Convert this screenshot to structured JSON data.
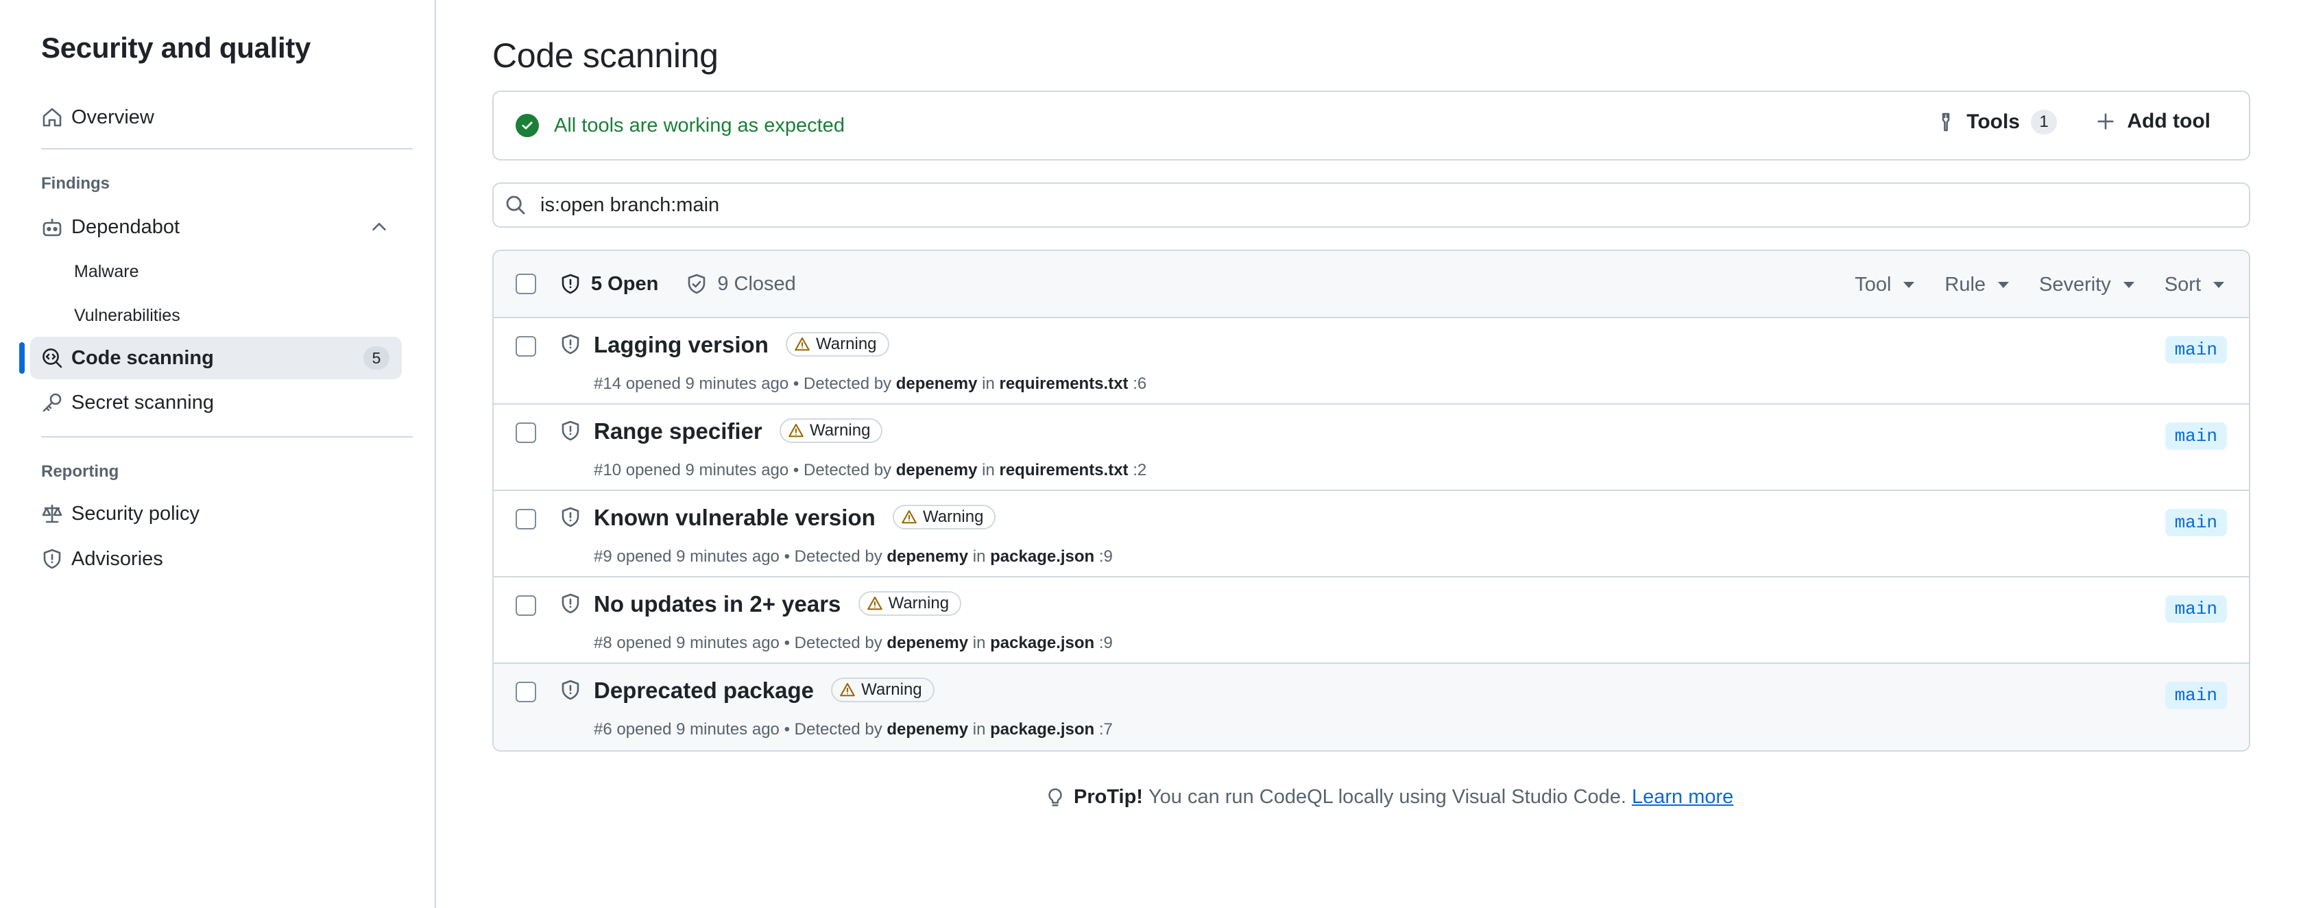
{
  "sidebar": {
    "title": "Security and quality",
    "overview": "Overview",
    "findings_heading": "Findings",
    "dependabot": "Dependabot",
    "malware": "Malware",
    "vulnerabilities": "Vulnerabilities",
    "code_scanning": "Code scanning",
    "code_scanning_count": "5",
    "secret_scanning": "Secret scanning",
    "reporting_heading": "Reporting",
    "security_policy": "Security policy",
    "advisories": "Advisories"
  },
  "main": {
    "title": "Code scanning",
    "status_text": "All tools are working as expected",
    "tools_label": "Tools",
    "tools_count": "1",
    "add_tool_label": "Add tool",
    "search_value": "is:open branch:main",
    "open_label": "5 Open",
    "closed_label": "9 Closed",
    "filters": [
      "Tool",
      "Rule",
      "Severity",
      "Sort"
    ]
  },
  "alerts": [
    {
      "title": "Lagging version",
      "severity": "Warning",
      "number": "#14",
      "opened": "opened 9 minutes ago",
      "detected": "Detected by",
      "tool": "depenemy",
      "in": "in",
      "file": "requirements.txt",
      "line": ":6",
      "branch": "main"
    },
    {
      "title": "Range specifier",
      "severity": "Warning",
      "number": "#10",
      "opened": "opened 9 minutes ago",
      "detected": "Detected by",
      "tool": "depenemy",
      "in": "in",
      "file": "requirements.txt",
      "line": ":2",
      "branch": "main"
    },
    {
      "title": "Known vulnerable version",
      "severity": "Warning",
      "number": "#9",
      "opened": "opened 9 minutes ago",
      "detected": "Detected by",
      "tool": "depenemy",
      "in": "in",
      "file": "package.json",
      "line": ":9",
      "branch": "main"
    },
    {
      "title": "No updates in 2+ years",
      "severity": "Warning",
      "number": "#8",
      "opened": "opened 9 minutes ago",
      "detected": "Detected by",
      "tool": "depenemy",
      "in": "in",
      "file": "package.json",
      "line": ":9",
      "branch": "main"
    },
    {
      "title": "Deprecated package",
      "severity": "Warning",
      "number": "#6",
      "opened": "opened 9 minutes ago",
      "detected": "Detected by",
      "tool": "depenemy",
      "in": "in",
      "file": "package.json",
      "line": ":7",
      "branch": "main"
    }
  ],
  "protip": {
    "label": "ProTip!",
    "text": "You can run CodeQL locally using Visual Studio Code.",
    "link": "Learn more"
  },
  "colors": {
    "accent": "#0969da",
    "success": "#1a7f37",
    "warning": "#9a6700",
    "border": "#d1d9e0"
  }
}
